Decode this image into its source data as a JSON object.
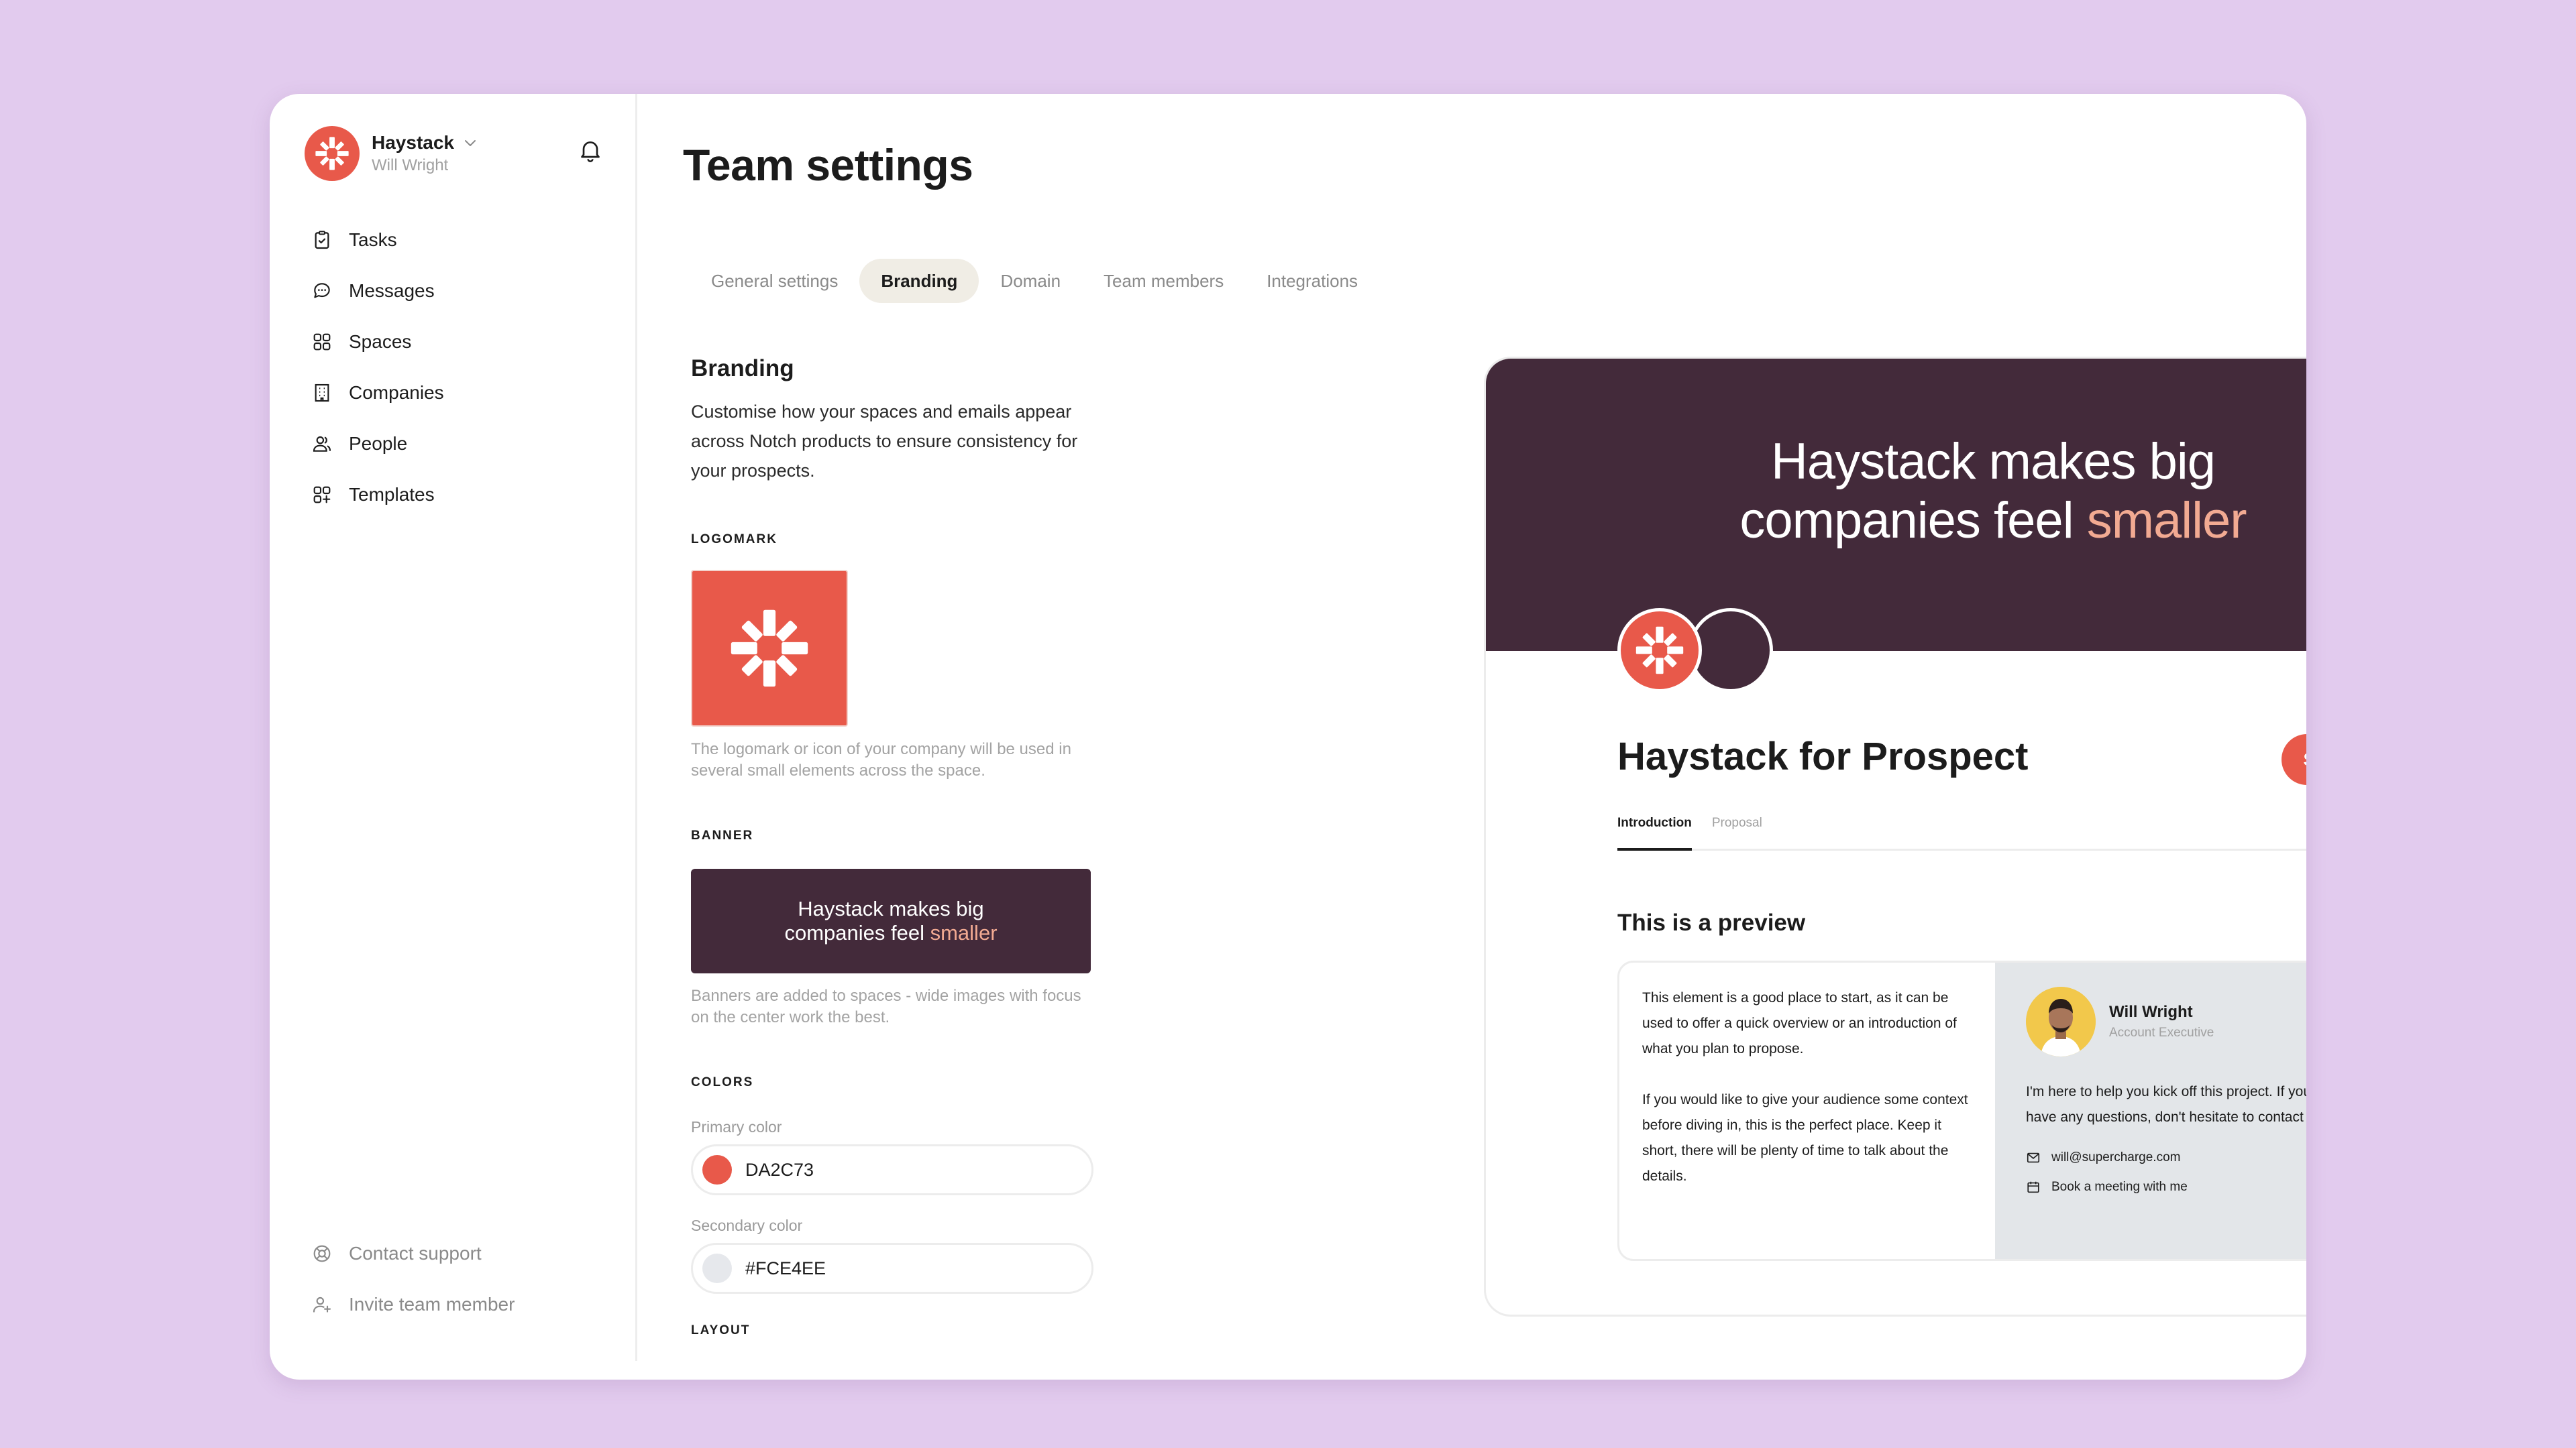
{
  "colors": {
    "background": "#e2cbee",
    "brand": "#e8594a",
    "banner": "#432a3a",
    "accent_text": "#f2aa92"
  },
  "sidebar": {
    "team_name": "Haystack",
    "team_user": "Will Wright",
    "items": [
      {
        "label": "Tasks",
        "icon": "clipboard-check-icon"
      },
      {
        "label": "Messages",
        "icon": "chat-bubble-icon"
      },
      {
        "label": "Spaces",
        "icon": "grid-squares-icon"
      },
      {
        "label": "Companies",
        "icon": "building-icon"
      },
      {
        "label": "People",
        "icon": "people-icon"
      },
      {
        "label": "Templates",
        "icon": "template-grid-icon"
      }
    ],
    "footer": [
      {
        "label": "Contact support",
        "icon": "lifebuoy-icon"
      },
      {
        "label": "Invite team member",
        "icon": "user-plus-icon"
      }
    ]
  },
  "page": {
    "title": "Team settings",
    "tabs": [
      "General settings",
      "Branding",
      "Domain",
      "Team members",
      "Integrations"
    ],
    "active_tab": "Branding"
  },
  "branding": {
    "title": "Branding",
    "description": "Customise how your spaces and emails appear across Notch products to ensure consistency for your prospects.",
    "logomark_label": "LOGOMARK",
    "logomark_hint": "The logomark or icon of your company will be used in several small elements across the space.",
    "banner_label": "BANNER",
    "banner_line1": "Haystack makes big",
    "banner_line2_prefix": "companies feel ",
    "banner_line2_accent": "smaller",
    "banner_hint": "Banners are added to spaces - wide images with focus on the center work the best.",
    "colors_label": "COLORS",
    "primary_label": "Primary color",
    "primary_value": "DA2C73",
    "primary_swatch": "#e8594a",
    "secondary_label": "Secondary color",
    "secondary_value": "#FCE4EE",
    "secondary_swatch": "#e6e8ec",
    "layout_label": "LAYOUT"
  },
  "preview": {
    "headline_line1": "Haystack makes big",
    "headline_line2_prefix": "companies feel ",
    "headline_line2_accent": "smaller",
    "title": "Haystack for Prospect",
    "share_label": "Share",
    "tabs": [
      "Introduction",
      "Proposal"
    ],
    "section_title": "This is a preview",
    "paragraph1": "This element is a good place to start, as it can be used to offer a quick overview or an introduction of what you plan to propose.",
    "paragraph2": "If you would like to give your audience some context before diving in, this is the perfect place. Keep it short, there will be plenty of time to talk about the details.",
    "contact": {
      "name": "Will Wright",
      "role": "Account Executive",
      "message": "I'm here to help you kick off this project. If you have any questions, don't hesitate to contact me!",
      "email": "will@supercharge.com",
      "meeting": "Book a meeting with me"
    }
  }
}
